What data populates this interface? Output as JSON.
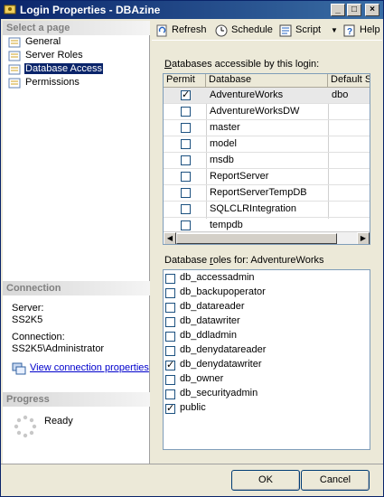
{
  "window": {
    "title": "Login Properties - DBAzine",
    "controls": [
      "minimize",
      "maximize",
      "close"
    ]
  },
  "left": {
    "select_page_header": "Select a page",
    "pages": [
      {
        "label": "General",
        "selected": false
      },
      {
        "label": "Server Roles",
        "selected": false
      },
      {
        "label": "Database Access",
        "selected": true
      },
      {
        "label": "Permissions",
        "selected": false
      }
    ],
    "connection_header": "Connection",
    "server_label": "Server:",
    "server_value": "SS2K5",
    "connection_label": "Connection:",
    "connection_value": "SS2K5\\Administrator",
    "view_props_link": "View connection properties",
    "progress_header": "Progress",
    "progress_status": "Ready"
  },
  "toolbar": {
    "refresh": "Refresh",
    "schedule": "Schedule",
    "script": "Script",
    "help": "Help"
  },
  "databases": {
    "label_prefix": "D",
    "label_rest": "atabases accessible by this login:",
    "columns": [
      "Permit",
      "Database",
      "Default Sc"
    ],
    "rows": [
      {
        "permit": true,
        "name": "AdventureWorks",
        "default_schema": "dbo",
        "selected": true
      },
      {
        "permit": false,
        "name": "AdventureWorksDW",
        "default_schema": ""
      },
      {
        "permit": false,
        "name": "master",
        "default_schema": ""
      },
      {
        "permit": false,
        "name": "model",
        "default_schema": ""
      },
      {
        "permit": false,
        "name": "msdb",
        "default_schema": ""
      },
      {
        "permit": false,
        "name": "ReportServer",
        "default_schema": ""
      },
      {
        "permit": false,
        "name": "ReportServerTempDB",
        "default_schema": ""
      },
      {
        "permit": false,
        "name": "SQLCLRIntegration",
        "default_schema": ""
      },
      {
        "permit": false,
        "name": "tempdb",
        "default_schema": ""
      }
    ]
  },
  "roles": {
    "label_pre": "Database ",
    "label_accel": "r",
    "label_post": "oles for: AdventureWorks",
    "items": [
      {
        "name": "db_accessadmin",
        "checked": false
      },
      {
        "name": "db_backupoperator",
        "checked": false
      },
      {
        "name": "db_datareader",
        "checked": false
      },
      {
        "name": "db_datawriter",
        "checked": false
      },
      {
        "name": "db_ddladmin",
        "checked": false
      },
      {
        "name": "db_denydatareader",
        "checked": false
      },
      {
        "name": "db_denydatawriter",
        "checked": true
      },
      {
        "name": "db_owner",
        "checked": false
      },
      {
        "name": "db_securityadmin",
        "checked": false
      },
      {
        "name": "public",
        "checked": true
      }
    ]
  },
  "buttons": {
    "ok": "OK",
    "cancel": "Cancel"
  },
  "colors": {
    "title_bar": "#0a246a",
    "selection": "#0a246a",
    "link": "#0000cc"
  }
}
